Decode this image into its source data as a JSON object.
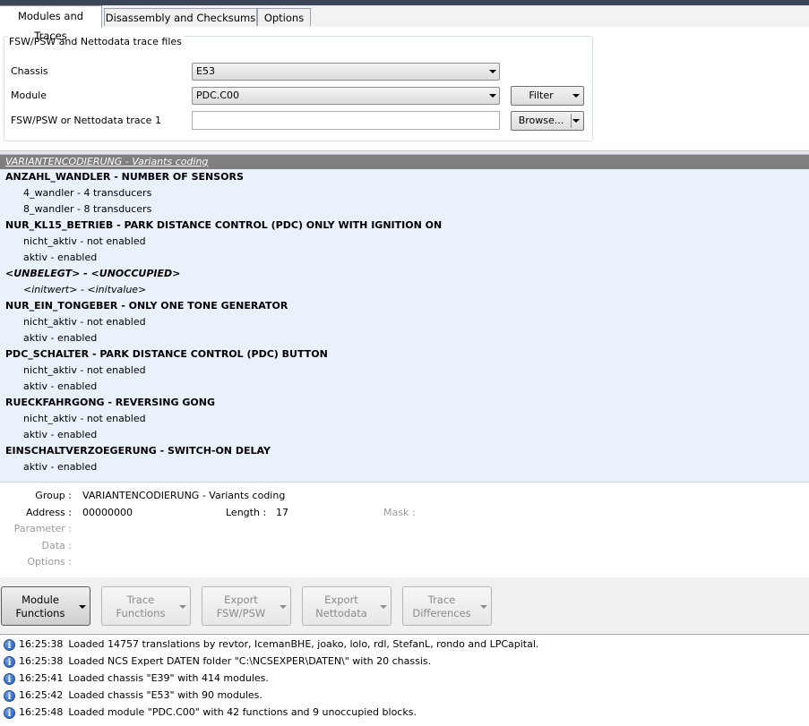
{
  "tabs": [
    {
      "label": "Modules and Traces"
    },
    {
      "label": "Disassembly and Checksums"
    },
    {
      "label": "Options"
    }
  ],
  "trace_files": {
    "legend": "FSW/PSW and Nettodata trace files",
    "chassis_label": "Chassis",
    "chassis_value": "E53",
    "module_label": "Module",
    "module_value": "PDC.C00",
    "trace_label": "FSW/PSW or Nettodata trace 1",
    "trace_value": "",
    "filter_button": "Filter",
    "browse_button": "Browse..."
  },
  "list": {
    "header": "VARIANTENCODIERUNG  -  Variants coding",
    "rows": [
      {
        "kind": "func",
        "text": "ANZAHL_WANDLER  -  NUMBER OF SENSORS"
      },
      {
        "kind": "opt",
        "text": "4_wandler  -  4 transducers"
      },
      {
        "kind": "opt",
        "text": "8_wandler  -  8 transducers"
      },
      {
        "kind": "func",
        "text": "NUR_KL15_BETRIEB  -  PARK DISTANCE CONTROL (PDC) ONLY WITH IGNITION ON"
      },
      {
        "kind": "opt",
        "text": "nicht_aktiv  -  not enabled"
      },
      {
        "kind": "opt",
        "text": "aktiv  -  enabled"
      },
      {
        "kind": "unocc",
        "text": "<UNBELEGT>  -  <UNOCCUPIED>"
      },
      {
        "kind": "unocc-opt",
        "text": "<initwert>  -  <initvalue>"
      },
      {
        "kind": "func",
        "text": "NUR_EIN_TONGEBER  -  ONLY ONE TONE GENERATOR"
      },
      {
        "kind": "opt",
        "text": "nicht_aktiv  -  not enabled"
      },
      {
        "kind": "opt",
        "text": "aktiv  -  enabled"
      },
      {
        "kind": "func",
        "text": "PDC_SCHALTER  -  PARK DISTANCE CONTROL (PDC) BUTTON"
      },
      {
        "kind": "opt",
        "text": "nicht_aktiv  -  not enabled"
      },
      {
        "kind": "opt",
        "text": "aktiv  -  enabled"
      },
      {
        "kind": "func",
        "text": "RUECKFAHRGONG  -  REVERSING GONG"
      },
      {
        "kind": "opt",
        "text": "nicht_aktiv  -  not enabled"
      },
      {
        "kind": "opt",
        "text": "aktiv  -  enabled"
      },
      {
        "kind": "func",
        "text": "EINSCHALTVERZOEGERUNG  -  SWITCH-ON DELAY"
      },
      {
        "kind": "opt",
        "text": "aktiv  -  enabled"
      }
    ]
  },
  "details": {
    "group_label": "Group :",
    "group_value": "VARIANTENCODIERUNG  -  Variants coding",
    "address_label": "Address :",
    "address_value": "00000000",
    "length_label": "Length :",
    "length_value": "17",
    "mask_label": "Mask :",
    "parameter_label": "Parameter :",
    "data_label": "Data :",
    "options_label": "Options :"
  },
  "toolbar": {
    "buttons": [
      {
        "line1": "Module",
        "line2": "Functions",
        "active": true
      },
      {
        "line1": "Trace",
        "line2": "Functions",
        "active": false
      },
      {
        "line1": "Export",
        "line2": "FSW/PSW",
        "active": false
      },
      {
        "line1": "Export",
        "line2": "Nettodata",
        "active": false
      },
      {
        "line1": "Trace",
        "line2": "Differences",
        "active": false
      }
    ]
  },
  "log": {
    "icon": "info-icon",
    "entries": [
      {
        "time": "16:25:38",
        "message": "Loaded 14757 translations by revtor, IcemanBHE, joako, lolo, rdl, StefanL, rondo and LPCapital."
      },
      {
        "time": "16:25:38",
        "message": "Loaded NCS Expert DATEN folder \"C:\\NCSEXPER\\DATEN\\\" with 20 chassis."
      },
      {
        "time": "16:25:41",
        "message": "Loaded chassis \"E39\" with 414 modules."
      },
      {
        "time": "16:25:42",
        "message": "Loaded chassis \"E53\" with 90 modules."
      },
      {
        "time": "16:25:48",
        "message": "Loaded module \"PDC.C00\" with 42 functions and 9 unoccupied blocks."
      }
    ]
  }
}
